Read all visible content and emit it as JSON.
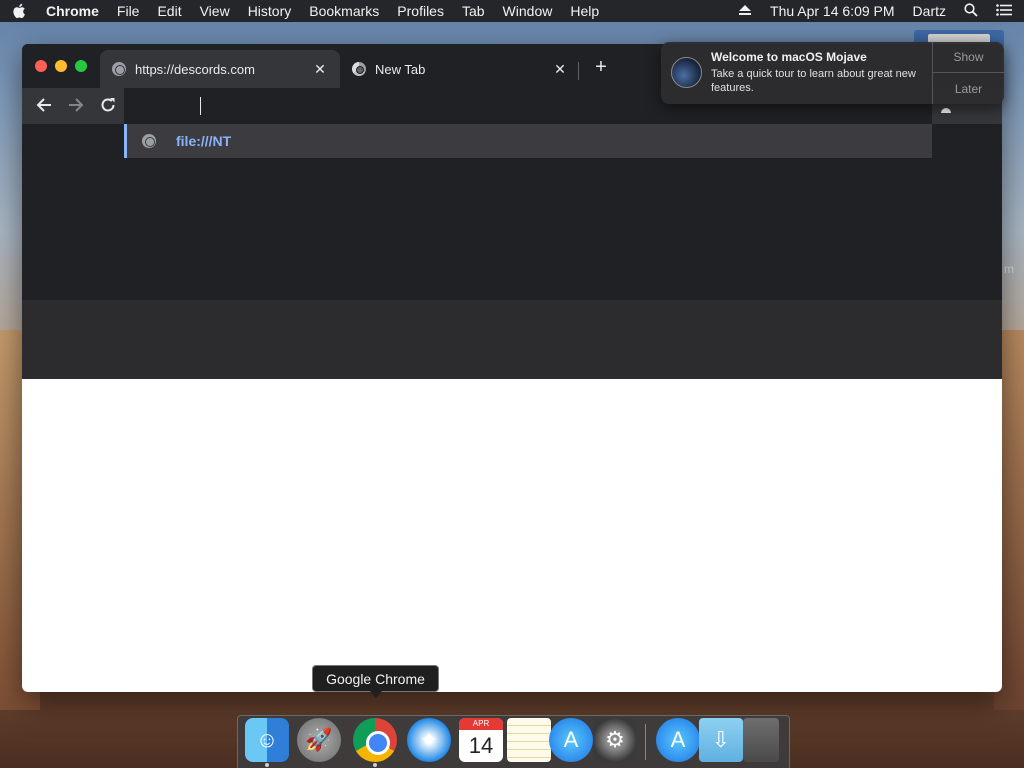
{
  "menubar": {
    "apple_icon": "apple-icon",
    "app_name": "Chrome",
    "items": [
      "File",
      "Edit",
      "View",
      "History",
      "Bookmarks",
      "Profiles",
      "Tab",
      "Window",
      "Help"
    ],
    "clock": "Thu Apr 14  6:09 PM",
    "user": "Dartz"
  },
  "browser": {
    "tabs": [
      {
        "title": "https://descords.com",
        "active": true
      },
      {
        "title": "New Tab",
        "active": false
      }
    ],
    "omnibox_value": "",
    "suggestion": "file:///NT"
  },
  "notification": {
    "title": "Welcome to macOS Mojave",
    "body": "Take a quick tour to learn about great new features.",
    "show_label": "Show",
    "later_label": "Later"
  },
  "dock": {
    "tooltip": "Google Chrome",
    "calendar_month": "APR",
    "calendar_day": "14"
  },
  "colors": {
    "accent_blue": "#8ab4f8",
    "window_bg": "#202124",
    "tab_active_bg": "#35363a"
  }
}
